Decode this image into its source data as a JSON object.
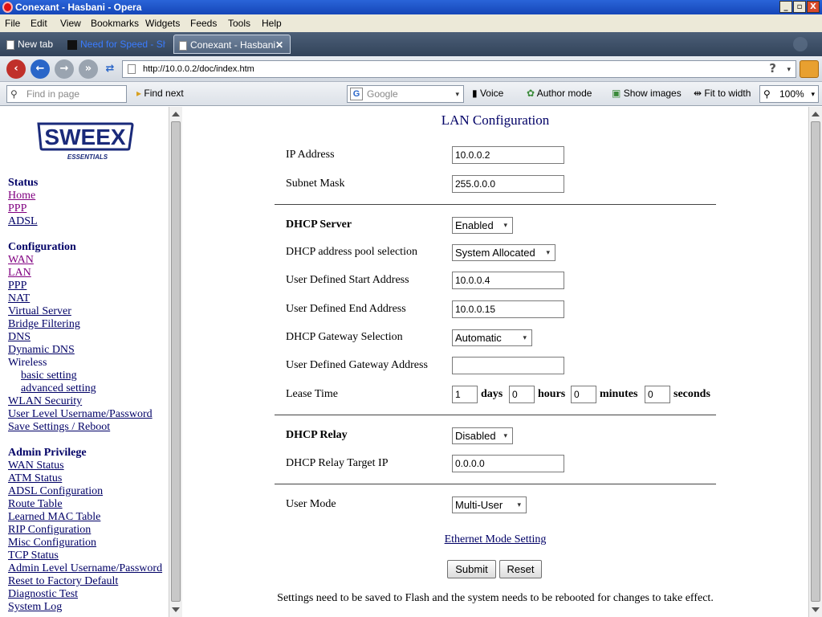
{
  "window": {
    "title": "Conexant - Hasbani - Opera",
    "controls": [
      "_",
      "▫",
      "X"
    ]
  },
  "menu": [
    "File",
    "Edit",
    "View",
    "Bookmarks",
    "Widgets",
    "Feeds",
    "Tools",
    "Help"
  ],
  "tabs": [
    {
      "label": "New tab"
    },
    {
      "label": "Need for Speed - Sh..."
    },
    {
      "label": "Conexant - Hasbani",
      "active": true
    }
  ],
  "address": {
    "url": "http://10.0.0.2/doc/index.htm"
  },
  "toolbar": {
    "find_placeholder": "Find in page",
    "find_next": "Find next",
    "search_engine": "Google",
    "voice": "Voice",
    "author_mode": "Author mode",
    "show_images": "Show images",
    "fit_to_width": "Fit to width",
    "zoom": "100%"
  },
  "logo": {
    "brand": "SWEEX",
    "tagline": "ESSENTIALS",
    "color": "#1a2a7a"
  },
  "sidebar": {
    "status": {
      "title": "Status",
      "items": [
        "Home",
        "PPP",
        "ADSL"
      ]
    },
    "configuration": {
      "title": "Configuration",
      "items": [
        "WAN",
        "LAN",
        "PPP",
        "NAT",
        "Virtual Server",
        "Bridge Filtering",
        "DNS",
        "Dynamic DNS"
      ],
      "wireless": "Wireless",
      "wireless_items": [
        "basic setting",
        "advanced setting"
      ],
      "more_items": [
        "WLAN Security",
        "User Level Username/Password",
        "Save Settings / Reboot"
      ]
    },
    "admin": {
      "title": "Admin Privilege",
      "items": [
        "WAN Status",
        "ATM Status",
        "ADSL Configuration",
        "Route Table",
        "Learned MAC Table",
        "RIP Configuration",
        "Misc Configuration",
        "TCP Status",
        "Admin Level Username/Password",
        "Reset to Factory Default",
        "Diagnostic Test",
        "System Log"
      ]
    }
  },
  "page": {
    "title": "LAN Configuration",
    "ip_address": {
      "label": "IP Address",
      "value": "10.0.0.2"
    },
    "subnet_mask": {
      "label": "Subnet Mask",
      "value": "255.0.0.0"
    },
    "dhcp_server": {
      "label": "DHCP Server",
      "value": "Enabled"
    },
    "pool_selection": {
      "label": "DHCP address pool selection",
      "value": "System Allocated"
    },
    "start_address": {
      "label": "User Defined Start Address",
      "value": "10.0.0.4"
    },
    "end_address": {
      "label": "User Defined End Address",
      "value": "10.0.0.15"
    },
    "gateway_selection": {
      "label": "DHCP Gateway Selection",
      "value": "Automatic"
    },
    "gateway_address": {
      "label": "User Defined Gateway Address",
      "value": ""
    },
    "lease_time": {
      "label": "Lease Time",
      "days": "1",
      "days_unit": "days",
      "hours": "0",
      "hours_unit": "hours",
      "minutes": "0",
      "minutes_unit": "minutes",
      "seconds": "0",
      "seconds_unit": "seconds"
    },
    "dhcp_relay": {
      "label": "DHCP Relay",
      "value": "Disabled"
    },
    "relay_target": {
      "label": "DHCP Relay Target IP",
      "value": "0.0.0.0"
    },
    "user_mode": {
      "label": "User Mode",
      "value": "Multi-User"
    },
    "ethernet_link": "Ethernet Mode Setting",
    "submit": "Submit",
    "reset": "Reset",
    "footer_note": "Settings need to be saved to Flash and the system needs to be rebooted for changes to take effect."
  }
}
